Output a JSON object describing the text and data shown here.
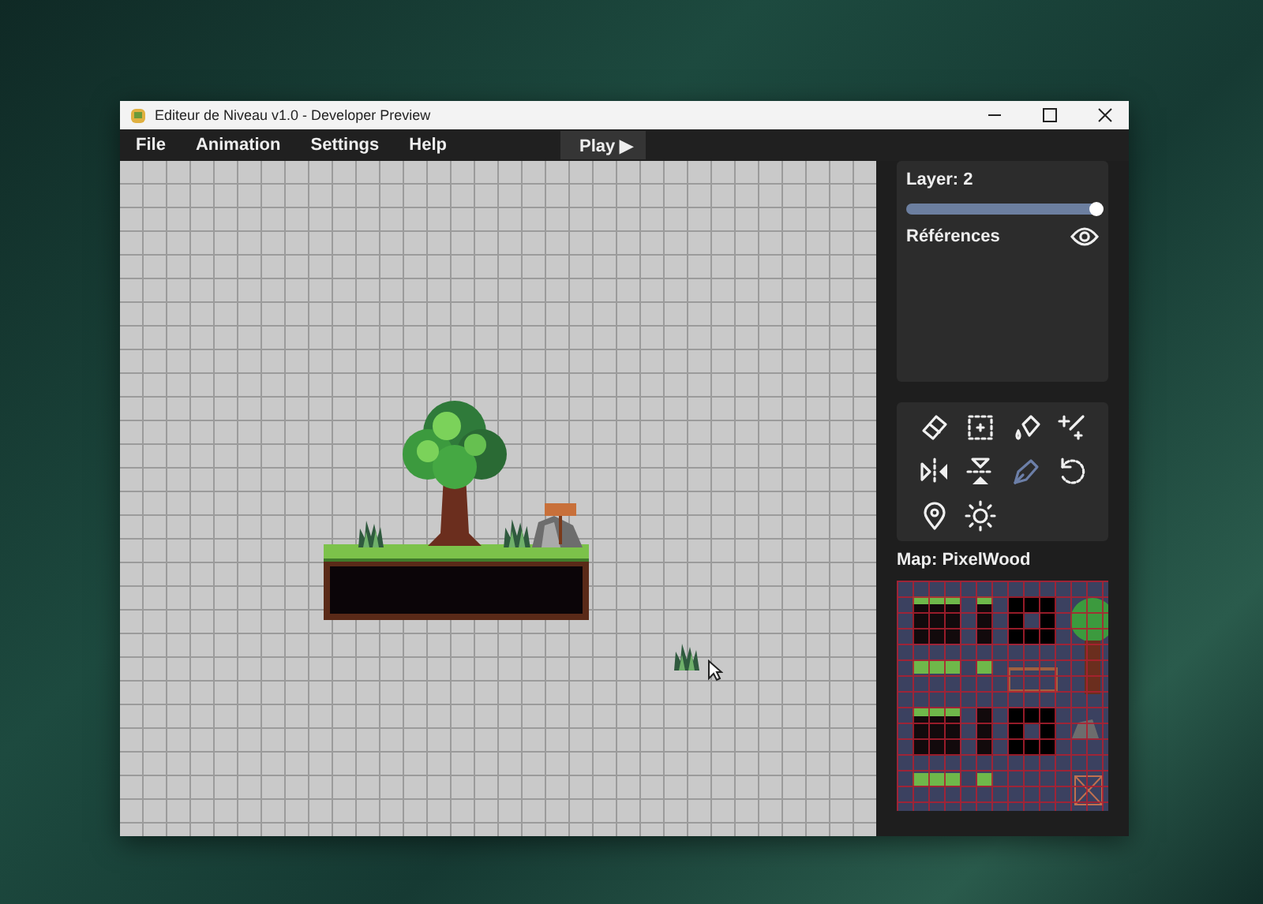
{
  "window": {
    "title": "Editeur de Niveau v1.0 - Developer Preview"
  },
  "menu": [
    "File",
    "Animation",
    "Settings",
    "Help"
  ],
  "play_button": {
    "label": "Play ▶"
  },
  "layer_panel": {
    "label": "Layer: 2",
    "level": 1,
    "references": "Références",
    "references_visible": true
  },
  "tools": [
    {
      "kind": "eraser",
      "selected": false
    },
    {
      "kind": "select",
      "selected": false
    },
    {
      "kind": "fill",
      "selected": false
    },
    {
      "kind": "magic",
      "selected": false
    },
    {
      "kind": "flip-h",
      "selected": false
    },
    {
      "kind": "flip-v",
      "selected": false
    },
    {
      "kind": "pen",
      "selected": true
    },
    {
      "kind": "rotate",
      "selected": false
    },
    {
      "kind": "pin",
      "selected": false
    },
    {
      "kind": "light",
      "selected": false
    }
  ],
  "map": {
    "label": "Map: PixelWood"
  }
}
